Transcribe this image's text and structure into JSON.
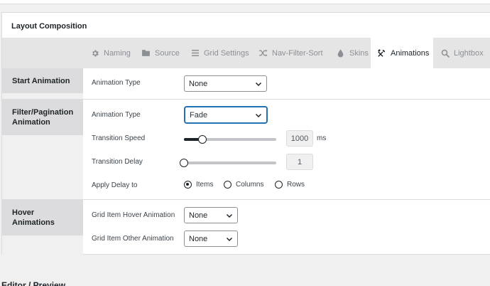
{
  "panel": {
    "title": "Layout Composition"
  },
  "tabs": [
    {
      "label": "Naming",
      "icon": "gear-icon"
    },
    {
      "label": "Source",
      "icon": "folder-icon"
    },
    {
      "label": "Grid Settings",
      "icon": "list-icon"
    },
    {
      "label": "Nav-Filter-Sort",
      "icon": "shuffle-icon"
    },
    {
      "label": "Skins",
      "icon": "drop-icon"
    },
    {
      "label": "Animations",
      "icon": "tools-icon",
      "active": true
    },
    {
      "label": "Lightbox",
      "icon": "search-icon"
    }
  ],
  "start_animation": {
    "label": "Start Animation",
    "animation_type_label": "Animation Type",
    "animation_type_value": "None"
  },
  "filter_animation": {
    "label": "Filter/Pagination Animation",
    "animation_type_label": "Animation Type",
    "animation_type_value": "Fade",
    "transition_speed_label": "Transition Speed",
    "transition_speed_value": "1000",
    "transition_speed_unit": "ms",
    "transition_speed_slider_fraction": 0.2,
    "transition_delay_label": "Transition Delay",
    "transition_delay_value": "1",
    "transition_delay_slider_fraction": 0.0,
    "apply_delay_label": "Apply Delay to",
    "apply_delay_options": [
      "Items",
      "Columns",
      "Rows"
    ],
    "apply_delay_selected": "Items"
  },
  "hover_animations": {
    "label": "Hover Animations",
    "grid_item_hover_label": "Grid Item Hover Animation",
    "grid_item_hover_value": "None",
    "grid_item_other_label": "Grid Item Other Animation",
    "grid_item_other_value": "None"
  },
  "footer": {
    "partial_heading": "Editor / Preview"
  },
  "colors": {
    "accent": "#2271b1",
    "text": "#1d2327",
    "muted": "#8c8f94",
    "tab_bar": "#e5e5e5"
  }
}
